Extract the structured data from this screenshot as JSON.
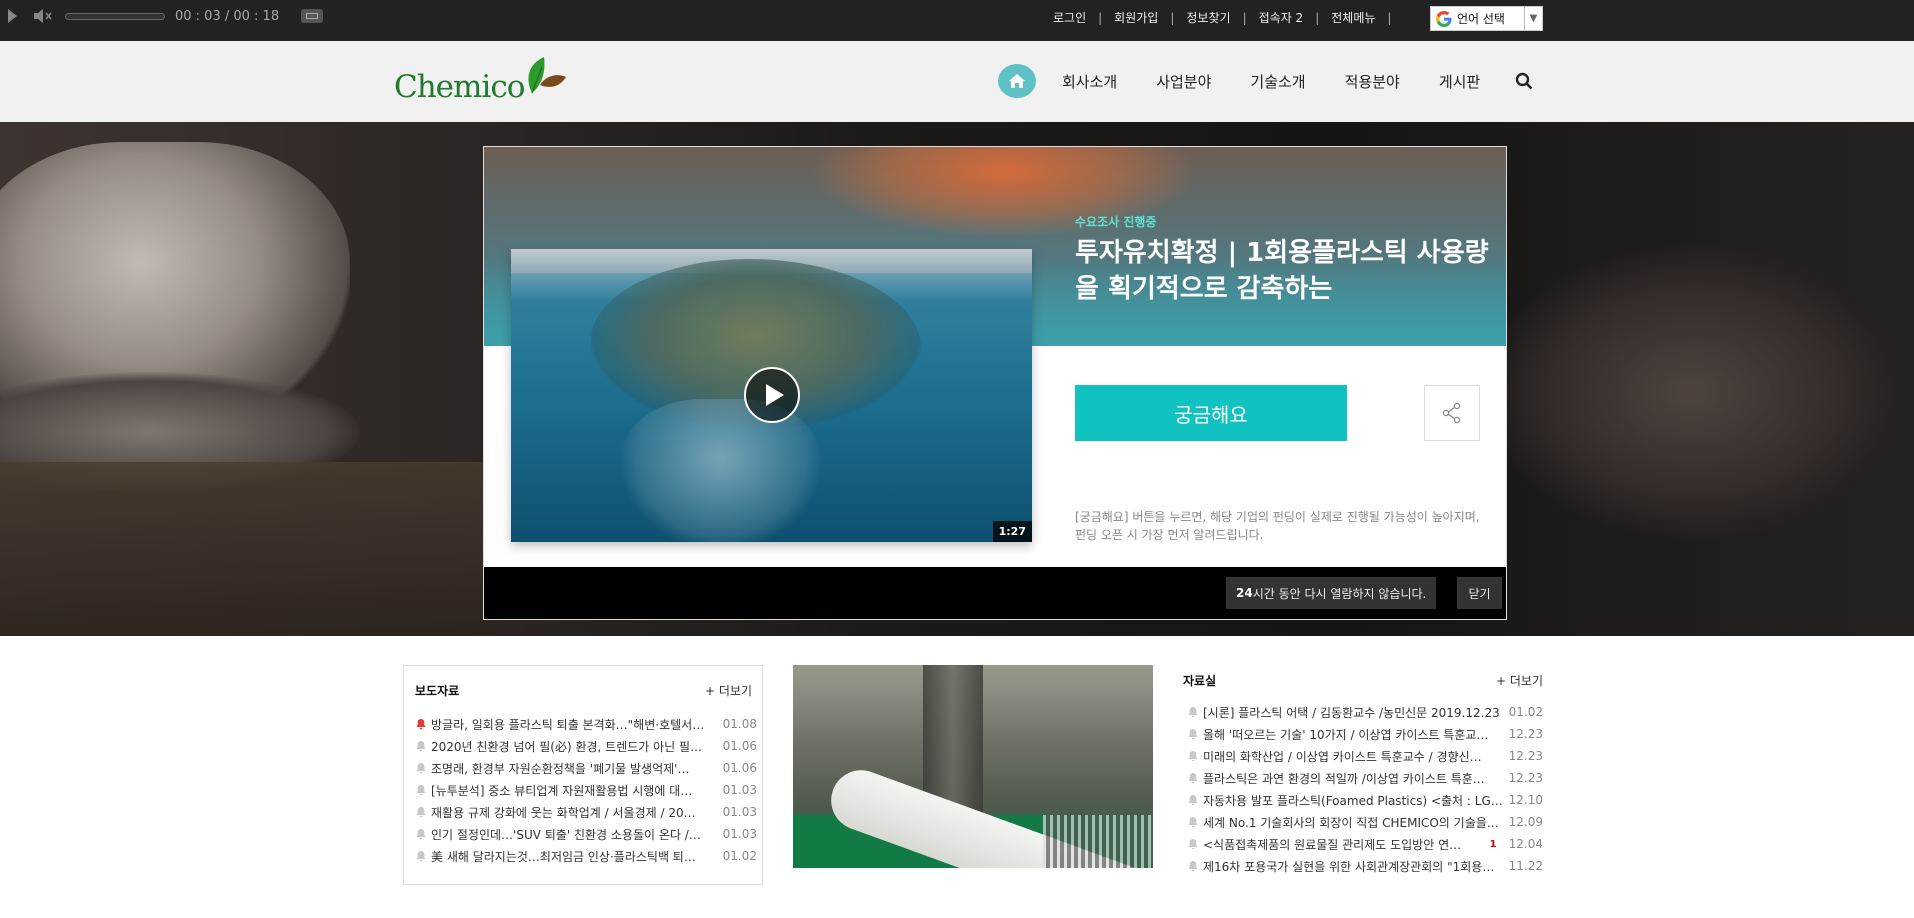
{
  "player": {
    "time": "00 : 03 / 00 : 18"
  },
  "util_links": [
    "로그인",
    "회원가입",
    "정보찾기",
    "접속자 2",
    "전체메뉴"
  ],
  "language": {
    "label": "언어 선택"
  },
  "brand": {
    "logo": "Chemico"
  },
  "nav": [
    "회사소개",
    "사업분야",
    "기술소개",
    "적용분야",
    "게시판"
  ],
  "popup": {
    "badge": "수요조사 진행중",
    "title": "투자유치확정 | 1회용플라스틱 사용량을 획기적으로 감축하는",
    "video_duration": "1:27",
    "cta": "궁금해요",
    "notice": "[궁금해요] 버튼을 누르면, 해당 기업의 펀딩이 실제로 진행될 가능성이 높아지며, 펀딩 오픈 시 가장 먼저 알려드립니다.",
    "no_show_bold": "24",
    "no_show_rest": "시간 동안 다시 열람하지 않습니다.",
    "close": "닫기"
  },
  "press": {
    "title": "보도자료",
    "more": "+ 더보기",
    "items": [
      {
        "title": "방글라, 일회용 플라스틱 퇴출 본격화…\"해변·호텔서…",
        "date": "01.08",
        "hot": true
      },
      {
        "title": "2020년 친환경 넘어 필(必) 환경, 트렌드가 아닌 필…",
        "date": "01.06",
        "hot": false
      },
      {
        "title": "조명래, 환경부 자원순환정책을 '폐기물 발생억제'…",
        "date": "01.06",
        "hot": false
      },
      {
        "title": "[뉴투분석] 중소 뷰티업계 자원재활용법 시행에 대…",
        "date": "01.03",
        "hot": false
      },
      {
        "title": "재활용 규제 강화에 웃는 화학업계 / 서울경제 / 20…",
        "date": "01.03",
        "hot": false
      },
      {
        "title": "인기 절정인데…'SUV 퇴출' 친환경 소용돌이 온다 /…",
        "date": "01.03",
        "hot": false
      },
      {
        "title": "美 새해 달라지는것…최저임금 인상·플라스틱백 퇴…",
        "date": "01.02",
        "hot": false
      }
    ]
  },
  "library": {
    "title": "자료실",
    "more": "+ 더보기",
    "items": [
      {
        "title": "[시론] 플라스틱 어택 / 김동환교수 /농민신문 2019.12.23",
        "date": "01.02",
        "count": ""
      },
      {
        "title": "올해 '떠오르는 기술' 10가지 / 이상엽 카이스트 특훈교…",
        "date": "12.23",
        "count": ""
      },
      {
        "title": "미래의 화학산업 / 이상엽 카이스트 특훈교수 / 경향신…",
        "date": "12.23",
        "count": ""
      },
      {
        "title": "플라스틱은 과연 환경의 적일까 /이상엽 카이스트 특훈…",
        "date": "12.23",
        "count": ""
      },
      {
        "title": "자동차용 발포 플라스틱(Foamed Plastics) <출처 : LG화…",
        "date": "12.10",
        "count": ""
      },
      {
        "title": "세계 No.1 기술회사의 회장이 직접 CHEMICO의 기술을…",
        "date": "12.09",
        "count": ""
      },
      {
        "title": "<식품접촉제품의 원료물질 관리제도 도입방안 연…",
        "date": "12.04",
        "count": "1"
      },
      {
        "title": "제16차 포용국가 실현을 위한 사회관계장관회의 \"1회용…",
        "date": "11.22",
        "count": ""
      }
    ]
  },
  "colors": {
    "accent": "#10c3c0",
    "home": "#5ec1c6",
    "logo_green": "#1e7a2c",
    "hot_bell": "#e53935"
  }
}
